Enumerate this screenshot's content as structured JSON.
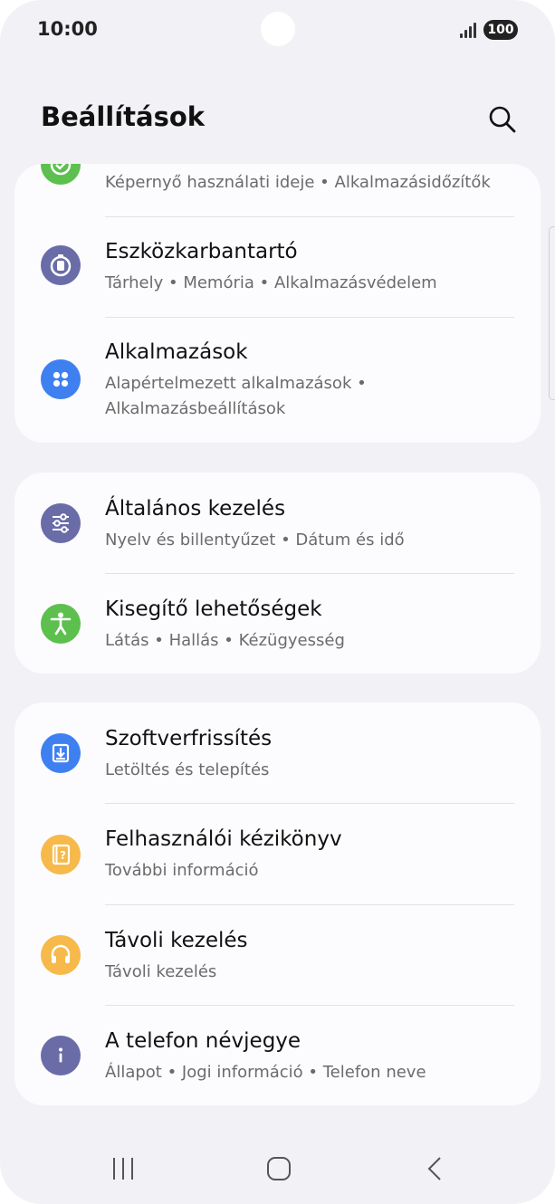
{
  "status_bar": {
    "time": "10:00",
    "battery": "100"
  },
  "header": {
    "title": "Beállítások"
  },
  "settings": [
    {
      "title": "",
      "subtitle": "Képernyő használati ideje  •  Alkalmazásidőzítők",
      "icon": "digital-wellbeing-icon",
      "color": "#5cbf4e"
    },
    {
      "title": "Eszközkarbantartó",
      "subtitle": "Tárhely  •  Memória  •  Alkalmazásvédelem",
      "icon": "device-care-icon",
      "color": "#6a6ca7"
    },
    {
      "title": "Alkalmazások",
      "subtitle_line1": "Alapértelmezett alkalmazások  •",
      "subtitle_line2": "Alkalmazásbeállítások",
      "icon": "apps-icon",
      "color": "#3f80f0"
    },
    {
      "title": "Általános kezelés",
      "subtitle": "Nyelv és billentyűzet  •  Dátum és idő",
      "icon": "sliders-icon",
      "color": "#6a6ca7"
    },
    {
      "title": "Kisegítő lehetőségek",
      "subtitle": "Látás  •  Hallás  •  Kézügyesség",
      "icon": "accessibility-icon",
      "color": "#5cbf4e"
    },
    {
      "title": "Szoftverfrissítés",
      "subtitle": "Letöltés és telepítés",
      "icon": "software-update-icon",
      "color": "#3f80f0"
    },
    {
      "title": "Felhasználói kézikönyv",
      "subtitle": "További információ",
      "icon": "user-manual-icon",
      "color": "#f6b94a"
    },
    {
      "title": "Távoli kezelés",
      "subtitle": "Távoli kezelés",
      "icon": "headset-icon",
      "color": "#f6b94a"
    },
    {
      "title": "A telefon névjegye",
      "subtitle": "Állapot  •  Jogi információ  •  Telefon neve",
      "icon": "info-icon",
      "color": "#6a6ca7"
    }
  ],
  "nav_bar": {
    "items": [
      "recent-apps",
      "home",
      "back"
    ]
  }
}
